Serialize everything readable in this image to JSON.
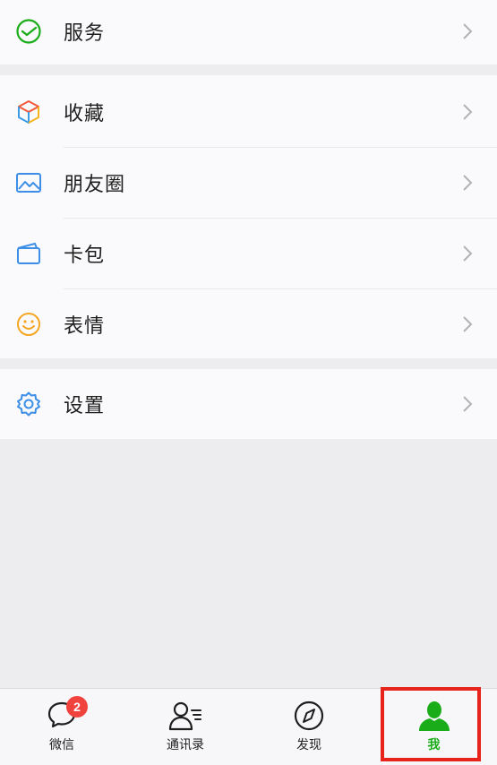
{
  "menu": {
    "services": {
      "label": "服务",
      "icon": "wechat-pay-icon"
    },
    "favorites": {
      "label": "收藏",
      "icon": "cube-icon"
    },
    "moments": {
      "label": "朋友圈",
      "icon": "image-icon"
    },
    "cards": {
      "label": "卡包",
      "icon": "card-icon"
    },
    "stickers": {
      "label": "表情",
      "icon": "smiley-icon"
    },
    "settings": {
      "label": "设置",
      "icon": "gear-icon"
    }
  },
  "tabbar": {
    "chats": {
      "label": "微信",
      "badge": "2",
      "icon": "chat-bubble-icon"
    },
    "contacts": {
      "label": "通讯录",
      "icon": "contacts-icon"
    },
    "discover": {
      "label": "发现",
      "icon": "compass-icon"
    },
    "me": {
      "label": "我",
      "icon": "person-icon",
      "active": true
    }
  },
  "colors": {
    "accent_green": "#1aad19",
    "badge_red": "#f0433e",
    "highlight_red": "#e8231c",
    "background": "#ededf0"
  }
}
